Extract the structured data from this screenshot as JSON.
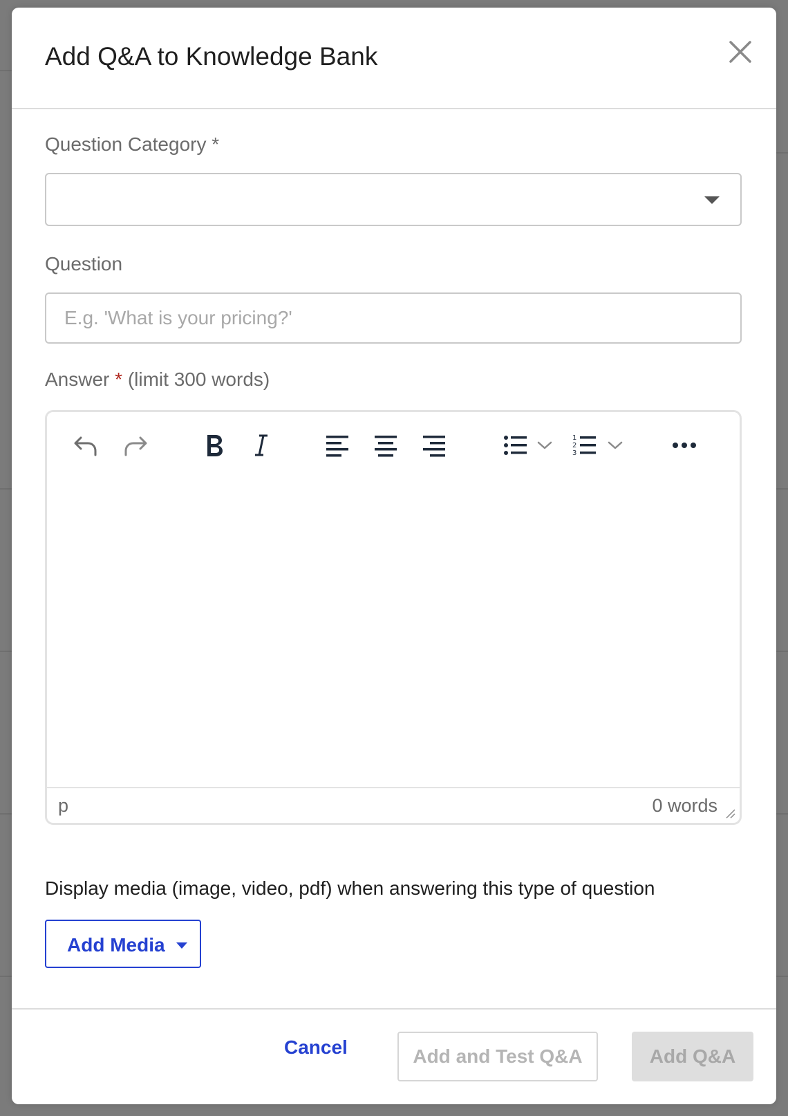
{
  "dialog": {
    "title": "Add Q&A to Knowledge Bank",
    "close_icon": "close-icon"
  },
  "category": {
    "label": "Question Category",
    "required_marker": "*",
    "selected_value": ""
  },
  "question": {
    "label": "Question",
    "value": "",
    "placeholder": "E.g. 'What is your pricing?'"
  },
  "answer": {
    "label": "Answer",
    "required_marker": "*",
    "limit_note": "(limit 300 words)",
    "toolbar": [
      "undo-icon",
      "redo-icon",
      "bold-icon",
      "italic-icon",
      "align-left-icon",
      "align-center-icon",
      "align-right-icon",
      "bullet-list-icon",
      "chevron-down-icon",
      "numbered-list-icon",
      "chevron-down-icon",
      "more-icon"
    ],
    "status_path": "p",
    "word_count": "0 words"
  },
  "media": {
    "description": "Display media (image, video, pdf) when answering this type of question",
    "add_button_label": "Add Media"
  },
  "footer": {
    "cancel_label": "Cancel",
    "add_test_label": "Add and Test Q&A",
    "add_label": "Add Q&A"
  },
  "colors": {
    "accent": "#2541d1",
    "required_star": "#b0271e",
    "overlay": "#7b7b7b",
    "disabled_text": "#b5b5b5"
  }
}
